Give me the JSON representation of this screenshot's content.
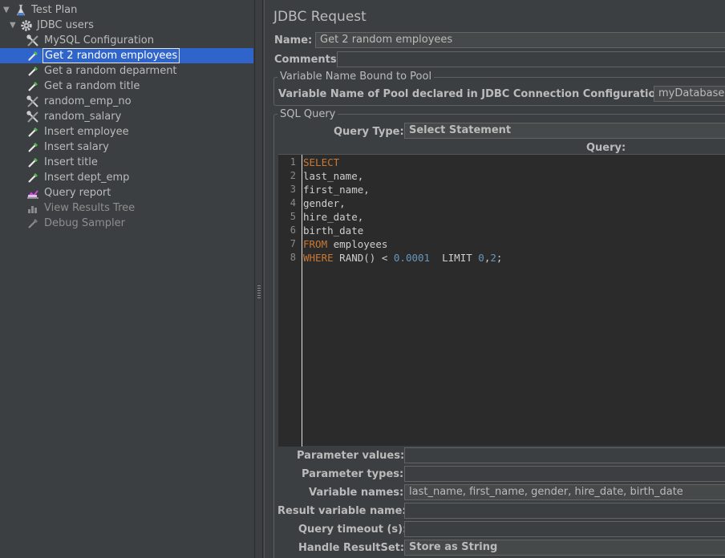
{
  "tree": {
    "items": [
      {
        "label": "Test Plan",
        "icon": "flask-icon",
        "level": 0,
        "expanded": true
      },
      {
        "label": "JDBC users",
        "icon": "gear-icon",
        "level": 1,
        "expanded": true
      },
      {
        "label": "MySQL Configuration",
        "icon": "wrench-scissors-icon",
        "level": 2
      },
      {
        "label": "Get 2 random employees",
        "icon": "pipette-icon",
        "level": 2,
        "selected": true
      },
      {
        "label": "Get a random deparment",
        "icon": "pipette-icon",
        "level": 2
      },
      {
        "label": "Get a random title",
        "icon": "pipette-icon",
        "level": 2
      },
      {
        "label": "random_emp_no",
        "icon": "wrench-scissors-icon",
        "level": 2
      },
      {
        "label": "random_salary",
        "icon": "wrench-scissors-icon",
        "level": 2
      },
      {
        "label": "Insert employee",
        "icon": "pipette-icon",
        "level": 2
      },
      {
        "label": "Insert salary",
        "icon": "pipette-icon",
        "level": 2
      },
      {
        "label": "Insert title",
        "icon": "pipette-icon",
        "level": 2
      },
      {
        "label": "Insert dept_emp",
        "icon": "pipette-icon",
        "level": 2
      },
      {
        "label": "Query report",
        "icon": "chart-icon",
        "level": 2
      },
      {
        "label": "View Results Tree",
        "icon": "bar-chart-icon",
        "level": 2,
        "disabled": true
      },
      {
        "label": "Debug Sampler",
        "icon": "pipette-icon",
        "level": 2,
        "disabled": true
      }
    ]
  },
  "panel": {
    "title": "JDBC Request",
    "name_label": "Name:",
    "name_value": "Get 2 random employees",
    "comments_label": "Comments:",
    "comments_value": "",
    "pool_group_title": "Variable Name Bound to Pool",
    "pool_label": "Variable Name of Pool declared in JDBC Connection Configuration:",
    "pool_value": "myDatabase",
    "sql_group_title": "SQL Query",
    "query_type_label": "Query Type:",
    "query_type_value": "Select Statement",
    "query_label": "Query:",
    "code_lines": [
      {
        "n": "1",
        "text": "SELECT"
      },
      {
        "n": "2",
        "text": "last_name,"
      },
      {
        "n": "3",
        "text": "first_name,"
      },
      {
        "n": "4",
        "text": "gender,"
      },
      {
        "n": "5",
        "text": "hire_date,"
      },
      {
        "n": "6",
        "text": "birth_date"
      },
      {
        "n": "7",
        "kw": "FROM",
        "text": " employees"
      },
      {
        "n": "8",
        "kw": "WHERE",
        "text": " RAND() < ",
        "num1": "0.0001",
        "text2": "  LIMIT ",
        "num2": "0",
        "text3": ",",
        "num3": "2",
        "text4": ";"
      }
    ],
    "param_values_label": "Parameter values:",
    "param_values_value": "",
    "param_types_label": "Parameter types:",
    "param_types_value": "",
    "var_names_label": "Variable names:",
    "var_names_value": "last_name, first_name, gender, hire_date, birth_date",
    "result_var_label": "Result variable name:",
    "result_var_value": "",
    "timeout_label": "Query timeout (s):",
    "timeout_value": "",
    "handle_label": "Handle ResultSet:",
    "handle_value": "Store as String"
  },
  "colors": {
    "selection": "#2f65ca",
    "keyword": "#cc7832",
    "number": "#6897bb"
  }
}
